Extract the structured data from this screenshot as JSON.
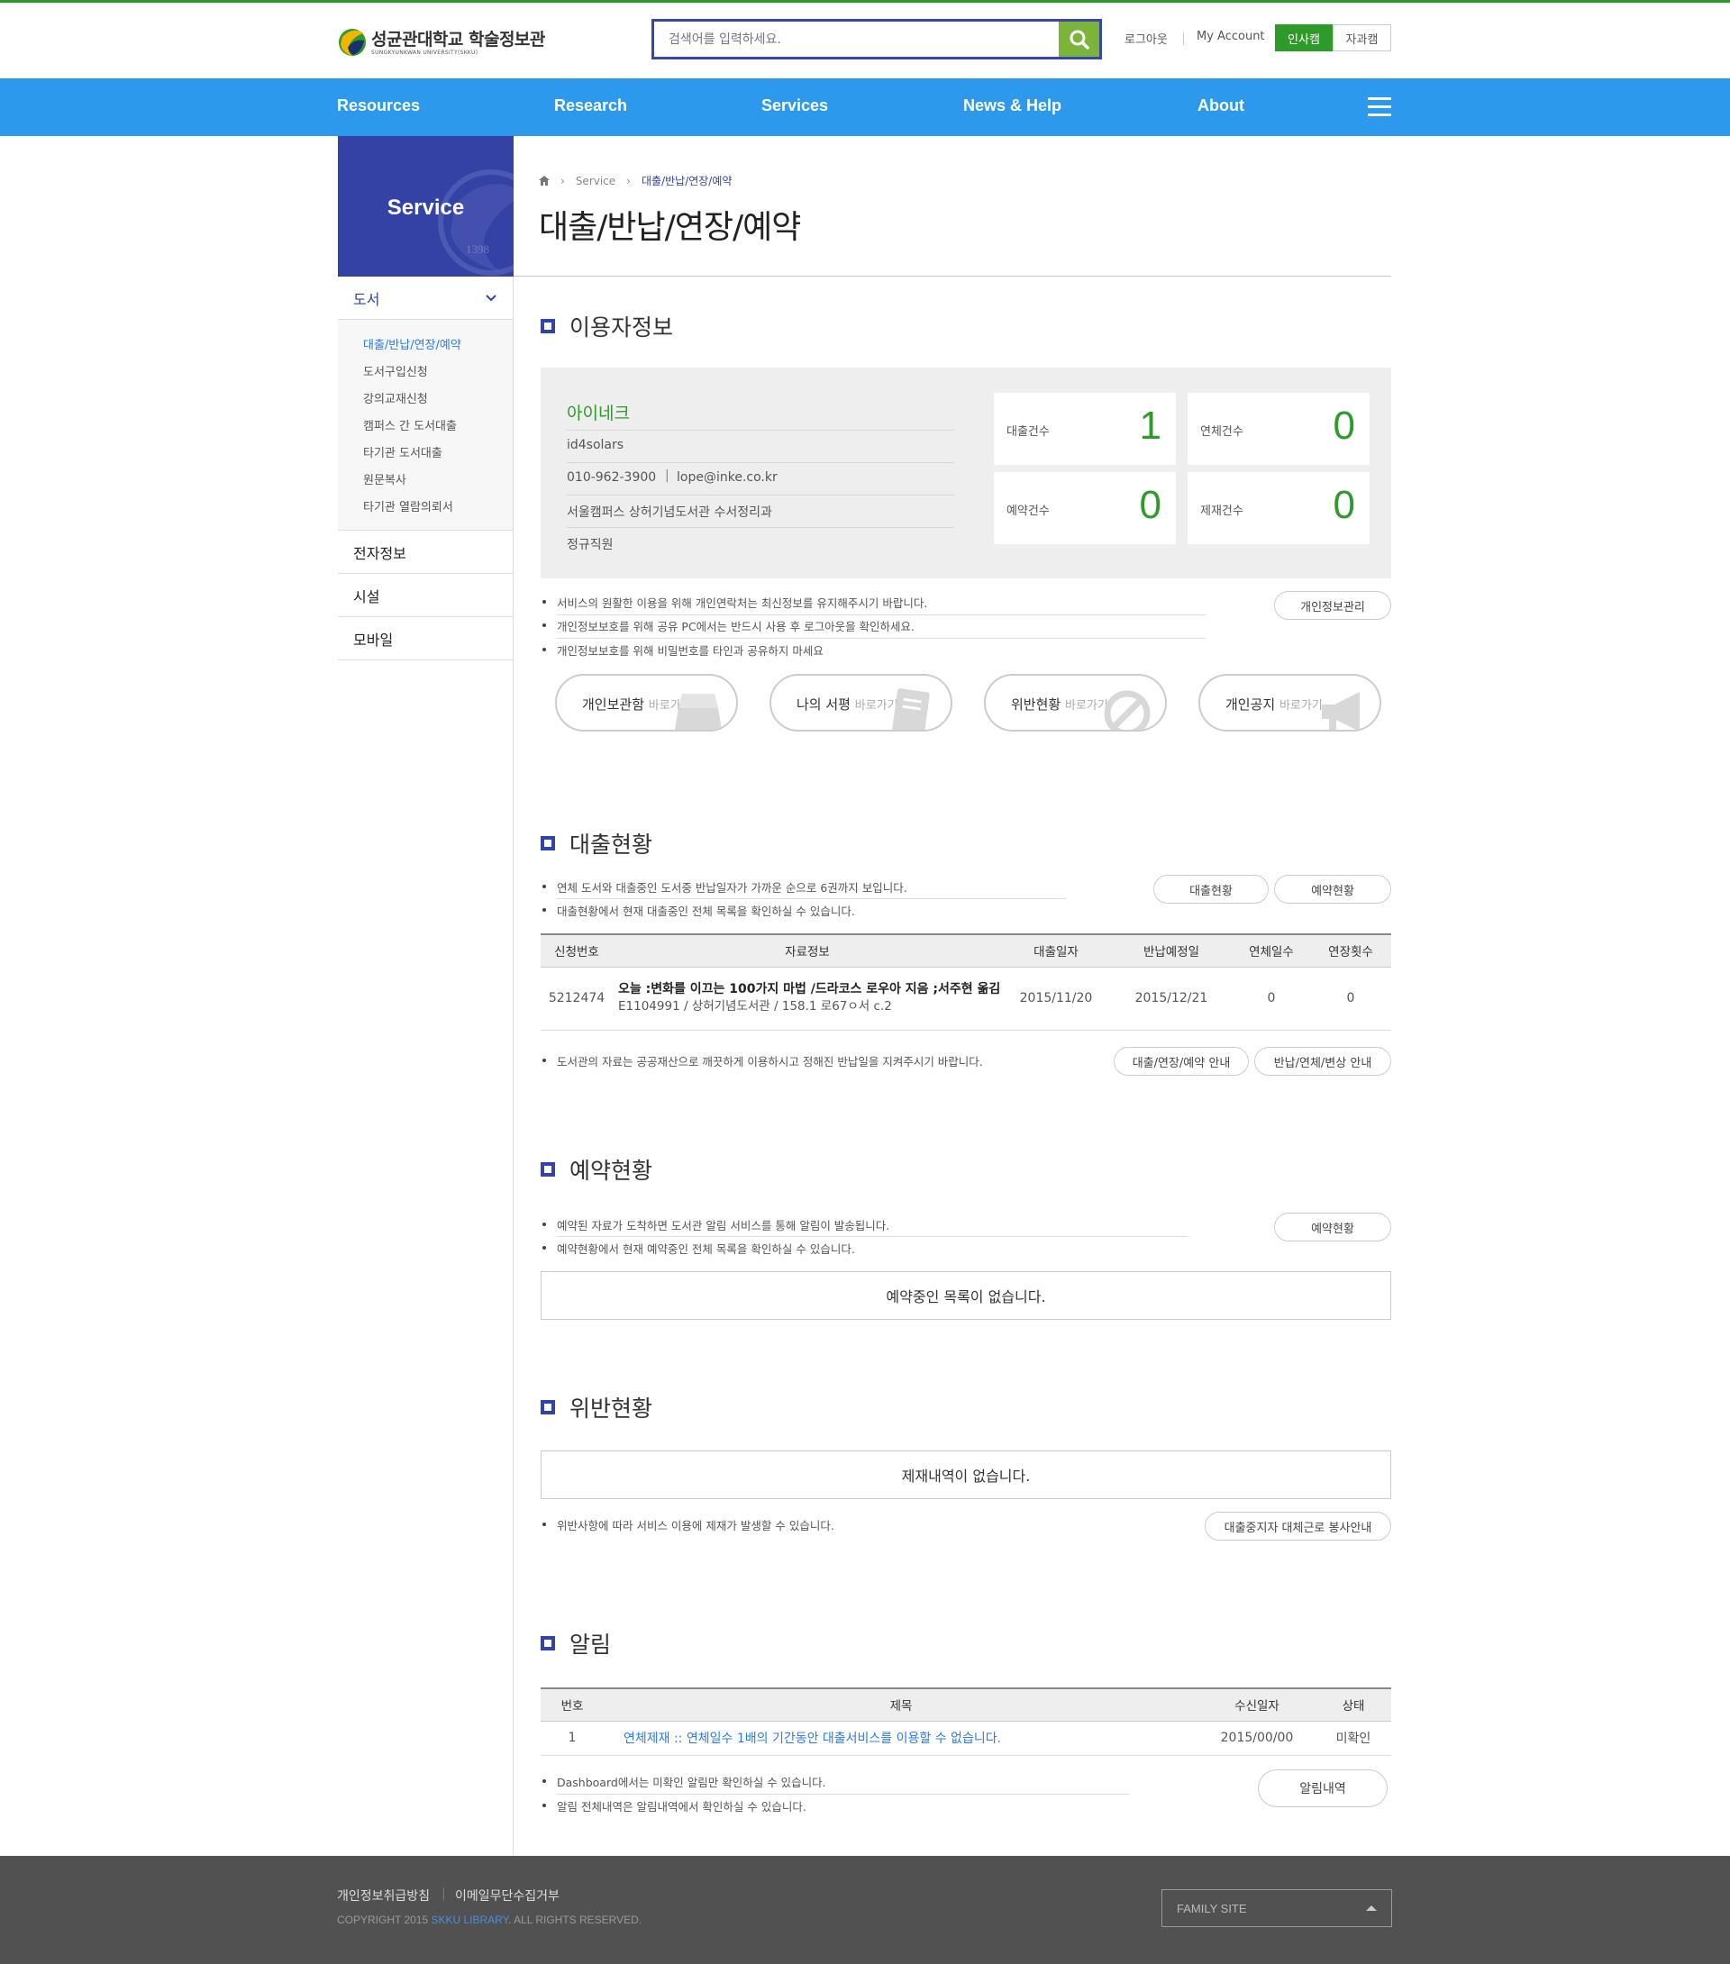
{
  "header": {
    "logo_text": "성균관대학교 학술정보관",
    "logo_sub": "SUNGKYUNKWAN UNIVERSITY(SKKU)",
    "search_placeholder": "검색어를 입력하세요.",
    "logout": "로그아웃",
    "my_account": "My Account",
    "campus_active": "인사캠",
    "campus_inactive": "자과캠"
  },
  "gnb": [
    "Resources",
    "Research",
    "Services",
    "News & Help",
    "About"
  ],
  "sidebar": {
    "title": "Service",
    "year": "1398",
    "categories": [
      {
        "label": "도서"
      },
      {
        "label": "전자정보"
      },
      {
        "label": "시설"
      },
      {
        "label": "모바일"
      }
    ],
    "sub_items": [
      "대출/반납/연장/예약",
      "도서구입신청",
      "강의교재신청",
      "캠퍼스 간 도서대출",
      "타기관 도서대출",
      "원문복사",
      "타기관 열람의뢰서"
    ]
  },
  "breadcrumb": {
    "level1": "Service",
    "current": "대출/반납/연장/예약"
  },
  "page_title": "대출/반납/연장/예약",
  "user_section": {
    "title": "이용자정보",
    "name": "아이네크",
    "id": "id4solars",
    "phone": "010-962-3900",
    "email": "lope@inke.co.kr",
    "dept": "서울캠퍼스 상허기념도서관 수서정리과",
    "status": "정규직원",
    "stats": [
      {
        "label": "대출건수",
        "value": "1"
      },
      {
        "label": "연체건수",
        "value": "0"
      },
      {
        "label": "예약건수",
        "value": "0"
      },
      {
        "label": "제재건수",
        "value": "0"
      }
    ],
    "notes": [
      "서비스의 원활한 이용을 위해 개인연락처는 최신정보를 유지해주시기 바랍니다.",
      "개인정보보호를 위해 공유 PC에서는 반드시 사용 후 로그아웃을 확인하세요.",
      "개인정보보호를 위해 비밀번호를 타인과 공유하지 마세요"
    ],
    "manage_button": "개인정보관리",
    "shortcuts": [
      {
        "label": "개인보관함",
        "sub": "바로가기"
      },
      {
        "label": "나의 서평",
        "sub": "바로가기"
      },
      {
        "label": "위반현황",
        "sub": "바로가기"
      },
      {
        "label": "개인공지",
        "sub": "바로가기"
      }
    ]
  },
  "loan_section": {
    "title": "대출현황",
    "notes": [
      "연체 도서와 대출중인 도서중 반납일자가 가까운 순으로 6권까지 보입니다.",
      "대출현황에서 현재 대출중인 전체 목록을 확인하실 수 있습니다."
    ],
    "buttons": [
      "대출현황",
      "예약현황"
    ],
    "columns": [
      "신청번호",
      "자료정보",
      "대출일자",
      "반납예정일",
      "연체일수",
      "연장횟수"
    ],
    "rows": [
      {
        "no": "5212474",
        "title": "오늘 :변화를 이끄는 100가지 마법 /드라코스 로우아 지음 ;서주현 옮김",
        "detail": "E1104991 /  상허기념도서관 / 158.1 로67ㅇ서 c.2",
        "loan_date": "2015/11/20",
        "due_date": "2015/12/21",
        "overdue": "0",
        "renew": "0"
      }
    ],
    "footer_note": "도서관의 자료는 공공재산으로 깨끗하게 이용하시고 정해진 반납일을 지켜주시기 바랍니다.",
    "footer_buttons": [
      "대출/연장/예약 안내",
      "반납/연체/변상 안내"
    ]
  },
  "reserve_section": {
    "title": "예약현황",
    "notes": [
      "예약된 자료가 도착하면 도서관 알림 서비스를 통해 알림이 발송됩니다.",
      "예약현황에서 현재 예약중인 전체 목록을 확인하실 수 있습니다."
    ],
    "button": "예약현황",
    "empty": "예약중인 목록이 없습니다."
  },
  "violation_section": {
    "title": "위반현황",
    "empty": "제재내역이 없습니다.",
    "note": "위반사항에 따라 서비스 이용에 제재가 발생할 수 있습니다.",
    "button": "대출중지자 대체근로 봉사안내"
  },
  "alert_section": {
    "title": "알림",
    "columns": [
      "번호",
      "제목",
      "수신일자",
      "상태"
    ],
    "rows": [
      {
        "no": "1",
        "title": "연체제재 :: 연체일수 1배의 기간동안 대출서비스를 이용할 수 없습니다.",
        "date": "2015/00/00",
        "status": "미확인"
      }
    ],
    "notes": [
      "Dashboard에서는 미확인 알림만 확인하실 수 있습니다.",
      "알림 전체내역은 알림내역에서 확인하실 수 있습니다."
    ],
    "button": "알림내역"
  },
  "footer": {
    "links": [
      "개인정보취급방침",
      "이메일무단수집거부"
    ],
    "copyright_pre": "COPYRIGHT 2015 ",
    "copyright_hl": "SKKU LIBRARY",
    "copyright_post": ". ALL RIGHTS RESERVED.",
    "family_site": "FAMILY SITE"
  },
  "colors": {
    "accent_blue": "#2d99ec",
    "brand_navy": "#3442a6",
    "brand_green": "#2d9a2a",
    "footer_bg": "#515152"
  }
}
